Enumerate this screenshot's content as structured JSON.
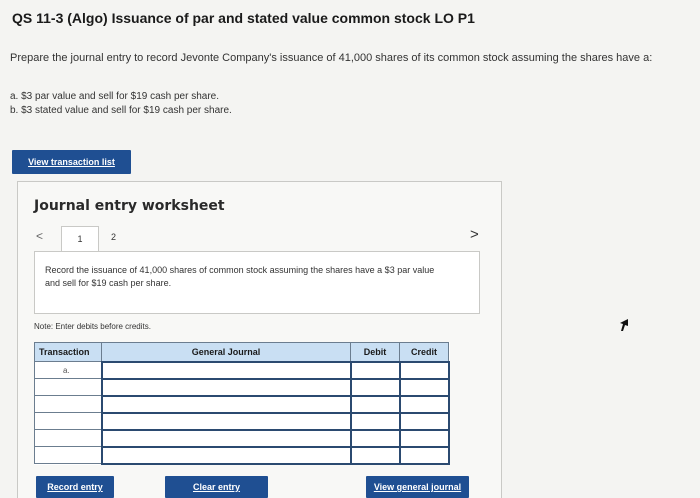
{
  "question": {
    "title": "QS 11-3 (Algo) Issuance of par and stated value common stock LO P1",
    "prompt": "Prepare the journal entry to record Jevonte Company's issuance of 41,000 shares of its common stock assuming the shares have a:",
    "parts": [
      "a.  $3 par value and sell for $19 cash per share.",
      "b.  $3 stated value and sell for $19 cash per share."
    ]
  },
  "buttons": {
    "view_transaction_list": "View transaction list",
    "record_entry": "Record entry",
    "clear_entry": "Clear entry",
    "view_general_journal": "View general journal"
  },
  "worksheet": {
    "title": "Journal entry worksheet",
    "nav_prev": "<",
    "nav_next": ">",
    "tabs": [
      "1",
      "2"
    ],
    "active_tab": "1",
    "description": "Record the issuance of 41,000 shares of common stock assuming the shares have a $3 par value and sell for $19 cash per share.",
    "note": "Note: Enter debits before credits.",
    "table": {
      "headers": {
        "transaction": "Transaction",
        "general_journal": "General Journal",
        "debit": "Debit",
        "credit": "Credit"
      },
      "rows": [
        {
          "transaction": "a.",
          "account": "",
          "debit": "",
          "credit": ""
        },
        {
          "transaction": "",
          "account": "",
          "debit": "",
          "credit": ""
        },
        {
          "transaction": "",
          "account": "",
          "debit": "",
          "credit": ""
        },
        {
          "transaction": "",
          "account": "",
          "debit": "",
          "credit": ""
        },
        {
          "transaction": "",
          "account": "",
          "debit": "",
          "credit": ""
        },
        {
          "transaction": "",
          "account": "",
          "debit": "",
          "credit": ""
        }
      ]
    }
  },
  "colors": {
    "button_blue": "#1f4f92",
    "table_header": "#c9dff3"
  },
  "icons": {
    "prev": "chevron-left-icon",
    "next": "chevron-right-icon",
    "cursor": "mouse-pointer-icon"
  }
}
